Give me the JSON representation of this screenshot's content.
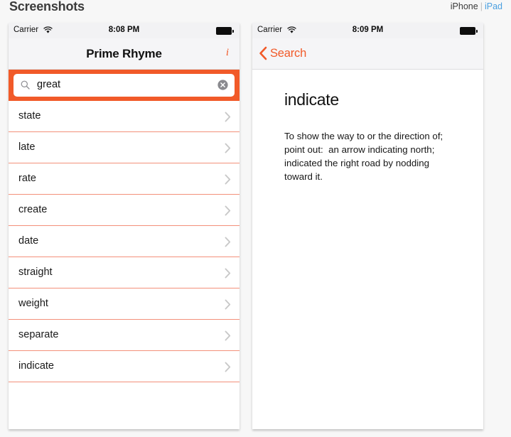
{
  "header": {
    "title": "Screenshots",
    "devices": [
      {
        "label": "iPhone",
        "selected": true
      },
      {
        "label": "iPad",
        "selected": false
      }
    ],
    "separator": "|"
  },
  "colors": {
    "accent_orange": "#f15a29",
    "separator_salmon": "#f3907a",
    "link_blue": "#4a9fe0",
    "page_background": "#f7f7f7",
    "navbar_background": "#f5f5f7",
    "statusbar_background": "#f2f2f4"
  },
  "phones": {
    "left": {
      "statusbar": {
        "carrier": "Carrier",
        "wifi_icon": "wifi-icon",
        "time": "8:08 PM",
        "battery_icon": "battery-icon"
      },
      "navbar": {
        "title": "Prime Rhyme",
        "info_label": "i"
      },
      "search": {
        "icon": "search-icon",
        "value": "great",
        "placeholder": "Search",
        "clear_icon": "clear-circle-icon"
      },
      "results": [
        {
          "word": "state"
        },
        {
          "word": "late"
        },
        {
          "word": "rate"
        },
        {
          "word": "create"
        },
        {
          "word": "date"
        },
        {
          "word": "straight"
        },
        {
          "word": "weight"
        },
        {
          "word": "separate"
        },
        {
          "word": "indicate"
        }
      ]
    },
    "right": {
      "statusbar": {
        "carrier": "Carrier",
        "wifi_icon": "wifi-icon",
        "time": "8:09 PM",
        "battery_icon": "battery-icon"
      },
      "navbar": {
        "back_label": "Search",
        "back_icon": "chevron-left-icon"
      },
      "detail": {
        "word": "indicate",
        "definition": "To show the way to or the direction of; point out:  an arrow indicating north; indicated the right road by nodding toward it."
      }
    }
  }
}
